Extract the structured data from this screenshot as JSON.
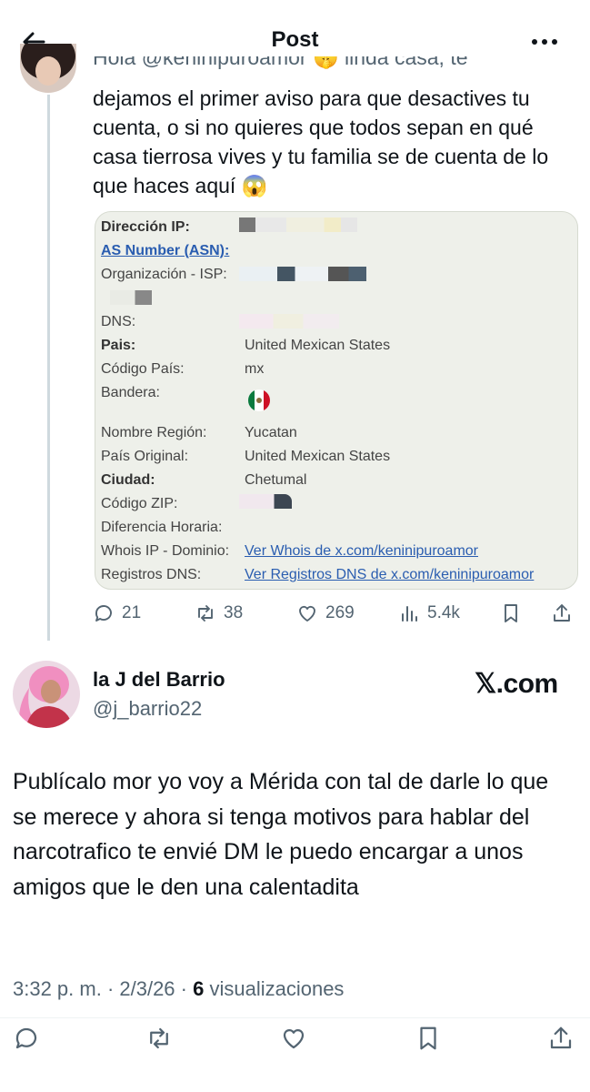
{
  "header": {
    "title": "Post"
  },
  "tweet1": {
    "cut_line": "Hola @keninipuroamor 🤫 linda casa, te",
    "text": "dejamos el primer aviso para que desactives tu cuenta, o si no quieres que todos sepan en qué casa tierrosa vives y tu familia se de cuenta de lo que haces aquí 😱",
    "card": {
      "ip_label": "Dirección IP:",
      "asn_label": "AS Number (ASN):",
      "isp_label": "Organización - ISP:",
      "dns_label": "DNS:",
      "pais_label": "Pais:",
      "pais_value": "United Mexican States",
      "codigo_pais_label": "Código País:",
      "codigo_pais_value": "mx",
      "bandera_label": "Bandera:",
      "region_label": "Nombre Región:",
      "region_value": "Yucatan",
      "pais_original_label": "País Original:",
      "pais_original_value": "United Mexican States",
      "ciudad_label": "Ciudad:",
      "ciudad_value": "Chetumal",
      "zip_label": "Código ZIP:",
      "diferencia_label": "Diferencia Horaria:",
      "whois_label": "Whois IP - Dominio:",
      "whois_link": "Ver Whois de x.com/keninipuroamor",
      "registros_label": "Registros DNS:",
      "registros_link": "Ver Registros DNS de x.com/keninipuroamor"
    },
    "actions": {
      "replies": "21",
      "reposts": "38",
      "likes": "269",
      "views": "5.4k"
    }
  },
  "tweet2": {
    "name": "la J del Barrio",
    "handle": "@j_barrio22",
    "watermark": "𝕏.com",
    "text": "Publícalo mor yo voy a Mérida con tal de darle lo que se merece y ahora si tenga motivos para hablar del narcotrafico te envié DM le puedo encargar a unos amigos que le den una calentadita",
    "time": "3:32 p. m. · 2/3/26 · ",
    "views_count": "6",
    "views_label": " visualizaciones"
  },
  "colors": {
    "accent": "#1d9bf0",
    "muted": "#536471",
    "card_bg": "#eef0ea",
    "link": "#2a5db0"
  },
  "icons": [
    "back-arrow-icon",
    "more-icon",
    "reply-icon",
    "repost-icon",
    "like-icon",
    "views-icon",
    "bookmark-icon",
    "share-icon",
    "mexico-flag-icon"
  ]
}
